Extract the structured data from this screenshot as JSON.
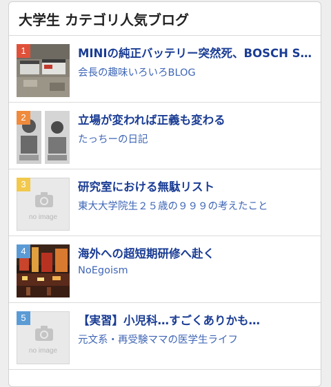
{
  "header": {
    "title": "大学生 カテゴリ人気ブログ"
  },
  "items": [
    {
      "rank": "1",
      "rank_color": "#e0513a",
      "title": "MINIの純正バッテリー突然死、BOSCH Sil…",
      "blog": "会長の趣味いろいろBLOG",
      "thumb": "photo-batteries"
    },
    {
      "rank": "2",
      "rank_color": "#f08a3c",
      "title": "立場が変われば正義も変わる",
      "blog": "たっちーの日記",
      "thumb": "photo-manga"
    },
    {
      "rank": "3",
      "rank_color": "#f2c94c",
      "title": "研究室における無駄リスト",
      "blog": "東大大学院生２５歳の９９９の考えたこと",
      "thumb": "no-image",
      "noimage_text": "no image"
    },
    {
      "rank": "4",
      "rank_color": "#5b9bd5",
      "title": "海外への超短期研修へ赴く",
      "blog": "NoEgoism",
      "thumb": "photo-city-night"
    },
    {
      "rank": "5",
      "rank_color": "#5b9bd5",
      "title": "【実習】小児科…すごくありかも…",
      "blog": "元文系・再受験ママの医学生ライフ",
      "thumb": "no-image",
      "noimage_text": "no image"
    }
  ]
}
